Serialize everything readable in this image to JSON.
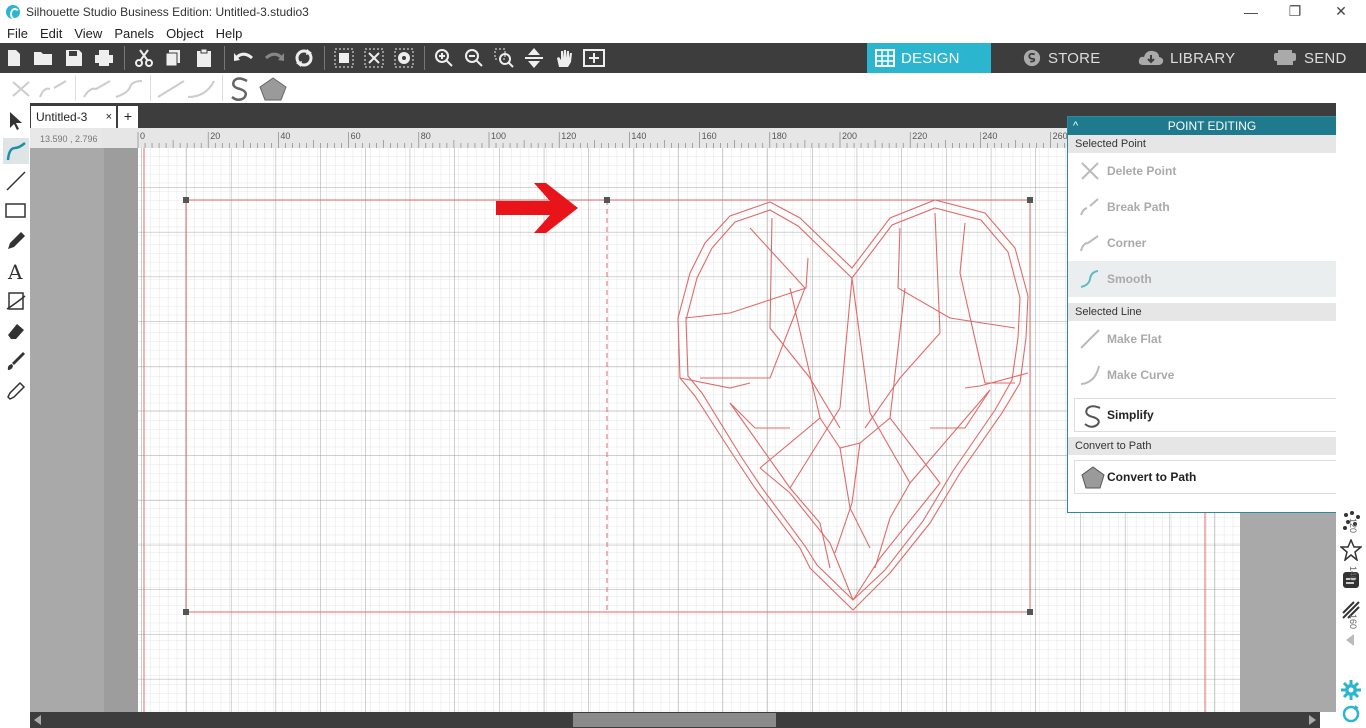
{
  "window": {
    "title": "Silhouette Studio Business Edition: Untitled-3.studio3",
    "minimize_glyph": "—",
    "restore_glyph": "❐",
    "close_glyph": "✕"
  },
  "menu": [
    "File",
    "Edit",
    "View",
    "Panels",
    "Object",
    "Help"
  ],
  "nav_tabs": [
    {
      "label": "DESIGN",
      "icon": "grid-icon",
      "active": true
    },
    {
      "label": "STORE",
      "icon": "silhouette-s-icon",
      "active": false
    },
    {
      "label": "LIBRARY",
      "icon": "cloud-download-icon",
      "active": false
    },
    {
      "label": "SEND",
      "icon": "cutter-icon",
      "active": false
    }
  ],
  "doc_tab": {
    "name": "Untitled-3",
    "close": "×",
    "add": "+"
  },
  "ruler": {
    "coords": "13.590 , 2.796",
    "top_ticks": [
      "0",
      "20",
      "40",
      "60",
      "80",
      "100",
      "120",
      "140",
      "160",
      "180",
      "200",
      "220",
      "240",
      "260"
    ],
    "right_ticks": [
      "120",
      "140",
      "160"
    ]
  },
  "panel": {
    "title": "POINT EDITING",
    "collapse_glyph": "^",
    "close_glyph": "×",
    "sections": {
      "selected_point": {
        "label": "Selected Point",
        "items": [
          {
            "label": "Delete Point",
            "icon": "delete-point-icon",
            "enabled": false
          },
          {
            "label": "Break Path",
            "icon": "break-path-icon",
            "enabled": false
          },
          {
            "label": "Corner",
            "icon": "corner-icon",
            "enabled": false
          },
          {
            "label": "Smooth",
            "icon": "smooth-icon",
            "enabled": false,
            "highlighted": true
          }
        ]
      },
      "selected_line": {
        "label": "Selected Line",
        "items": [
          {
            "label": "Make Flat",
            "icon": "make-flat-icon",
            "enabled": false
          },
          {
            "label": "Make Curve",
            "icon": "make-curve-icon",
            "enabled": false
          }
        ],
        "button": {
          "label": "Simplify",
          "icon": "simplify-icon"
        }
      },
      "convert": {
        "label": "Convert to Path",
        "button": {
          "label": "Convert to Path",
          "icon": "pentagon-icon"
        }
      }
    }
  },
  "colors": {
    "accent": "#2bb5cf",
    "panel_header": "#1e7a8c",
    "toolbar": "#3d3d3d",
    "cut_line": "#e06a6a",
    "arrow": "#e8141a"
  }
}
